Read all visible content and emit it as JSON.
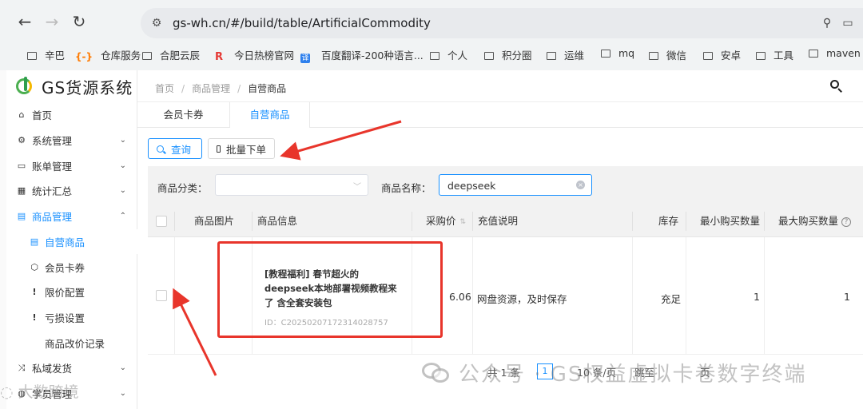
{
  "browser": {
    "url": "gs-wh.cn/#/build/table/ArtificialCommodity",
    "bookmarks": [
      {
        "label": "辛巴",
        "icon": "folder-icon"
      },
      {
        "label": "仓库服务",
        "icon": "bracket-icon"
      },
      {
        "label": "合肥云辰",
        "icon": "folder-icon"
      },
      {
        "label": "今日热榜官网",
        "icon": "r-logo-icon"
      },
      {
        "label": "百度翻译-200种语言...",
        "icon": "translate-icon"
      },
      {
        "label": "个人",
        "icon": "folder-icon"
      },
      {
        "label": "积分圈",
        "icon": "folder-icon"
      },
      {
        "label": "运维",
        "icon": "folder-icon"
      },
      {
        "label": "mq",
        "icon": "folder-icon"
      },
      {
        "label": "微信",
        "icon": "folder-icon"
      },
      {
        "label": "安卓",
        "icon": "folder-icon"
      },
      {
        "label": "工具",
        "icon": "folder-icon"
      },
      {
        "label": "maven",
        "icon": "folder-icon"
      }
    ]
  },
  "app": {
    "logo_text": "GS货源系统",
    "accent": "#1890ff",
    "breadcrumb": [
      "首页",
      "商品管理",
      "自营商品"
    ],
    "sidebar": [
      {
        "label": "首页",
        "icon": "home-icon"
      },
      {
        "label": "系统管理",
        "icon": "gears-icon",
        "chevron": "⌄"
      },
      {
        "label": "账单管理",
        "icon": "card-icon",
        "chevron": "⌄"
      },
      {
        "label": "统计汇总",
        "icon": "grid-icon",
        "chevron": "⌄"
      },
      {
        "label": "商品管理",
        "icon": "calendar-icon",
        "chevron": "⌃"
      },
      {
        "label": "自营商品",
        "icon": "calendar-icon"
      },
      {
        "label": "会员卡券",
        "icon": "hexagon-icon"
      },
      {
        "label": "限价配置",
        "icon": "exclamation-icon"
      },
      {
        "label": "亏损设置",
        "icon": "exclamation-icon"
      },
      {
        "label": "商品改价记录",
        "icon": ""
      },
      {
        "label": "私域发货",
        "icon": "shuffle-icon",
        "chevron": "⌄"
      },
      {
        "label": "学员管理",
        "icon": "user-icon",
        "chevron": "⌄"
      }
    ],
    "tabs": [
      "会员卡券",
      "自营商品"
    ],
    "toolbar": {
      "query": "查询",
      "batch": "批量下单"
    },
    "filter": {
      "category_label": "商品分类：",
      "name_label": "商品名称：",
      "name_value": "deepseek"
    },
    "table": {
      "columns": [
        "商品图片",
        "商品信息",
        "采购价",
        "充值说明",
        "库存",
        "最小购买数量",
        "最大购买数量"
      ],
      "rows": [
        {
          "title": "[教程福利] 春节超火的deepseek本地部署视频教程来了 含全套安装包",
          "id": "ID：C20250207172314028757",
          "price": "6.06",
          "desc": "网盘资源，及时保存",
          "stock": "充足",
          "min": "1",
          "max": "1"
        }
      ]
    },
    "pager": {
      "total": "共 1 条",
      "page": "1",
      "per_page": "10 条/页",
      "jump": "跳至",
      "page_suffix": "页"
    }
  },
  "watermark": {
    "main": "公众号 · GS权益虚拟卡卷数字终端",
    "corner": "大数跨境"
  }
}
